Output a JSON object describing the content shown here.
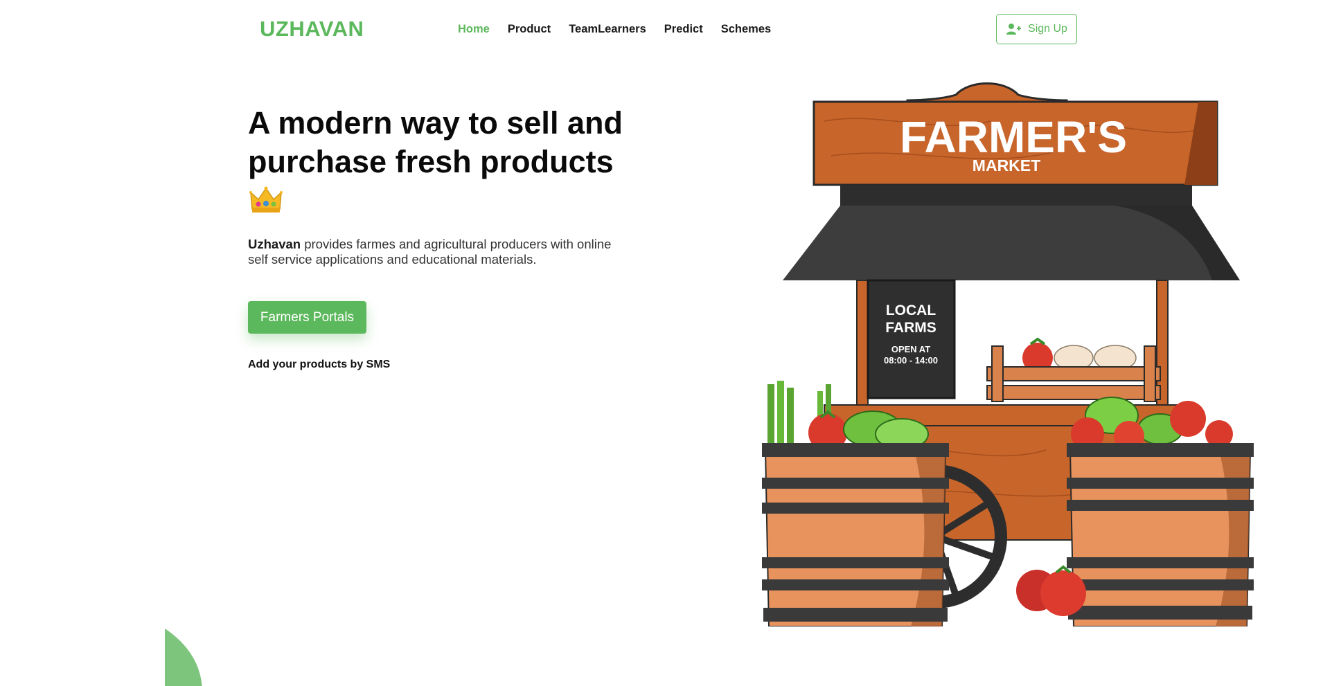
{
  "header": {
    "brand": "UZHAVAN",
    "nav": [
      {
        "label": "Home",
        "active": true
      },
      {
        "label": "Product",
        "active": false
      },
      {
        "label": "TeamLearners",
        "active": false
      },
      {
        "label": "Predict",
        "active": false
      },
      {
        "label": "Schemes",
        "active": false
      }
    ],
    "signup_label": "Sign Up",
    "signup_icon": "user-plus-icon"
  },
  "hero": {
    "title": "A modern way to sell and purchase fresh products",
    "title_icon": "crown-icon",
    "desc_bold": "Uzhavan",
    "desc_rest": " provides farmes and agricultural producers with online self service applications and educational materials.",
    "button_label": "Farmers Portals",
    "sms_note": "Add your products by SMS"
  },
  "illustration": {
    "sign_title": "FARMER'S",
    "sign_subtitle": "MARKET",
    "board_line1": "LOCAL",
    "board_line2": "FARMS",
    "board_line3": "OPEN AT",
    "board_line4": "08:00 - 14:00"
  },
  "colors": {
    "accent": "#5cb85c",
    "wood": "#c8652a",
    "roof": "#3a3a3a"
  }
}
